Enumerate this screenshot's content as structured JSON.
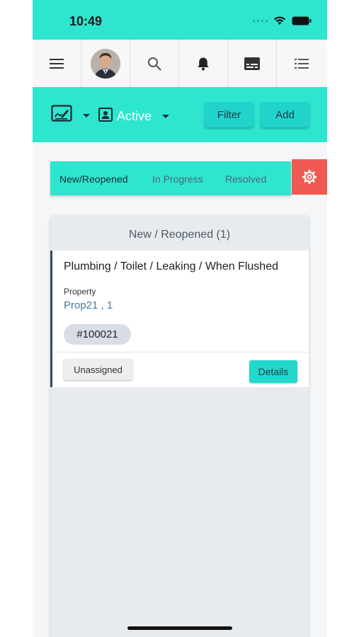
{
  "status_bar": {
    "time": "10:49"
  },
  "nav": {
    "icons": [
      "hamburger-menu-icon",
      "avatar",
      "search-icon",
      "bell-icon",
      "subtitles-icon",
      "list-icon"
    ]
  },
  "toolbar": {
    "status_label": "Active",
    "filter_label": "Filter",
    "add_label": "Add"
  },
  "tabs": [
    {
      "label": "New/Reopened",
      "active": true
    },
    {
      "label": "In Progress",
      "active": false
    },
    {
      "label": "Resolved",
      "active": false
    }
  ],
  "panel": {
    "title": "New / Reopened (1)",
    "card": {
      "title": "Plumbing / Toilet / Leaking / When Flushed",
      "property_label": "Property",
      "property_value": "Prop21 , 1",
      "ticket_id": "#100021",
      "assignee_label": "Unassigned",
      "details_label": "Details"
    }
  },
  "colors": {
    "accent": "#2ee5d0",
    "button": "#22d3cc",
    "settings_button": "#ee5a52",
    "link": "#4479a0"
  }
}
